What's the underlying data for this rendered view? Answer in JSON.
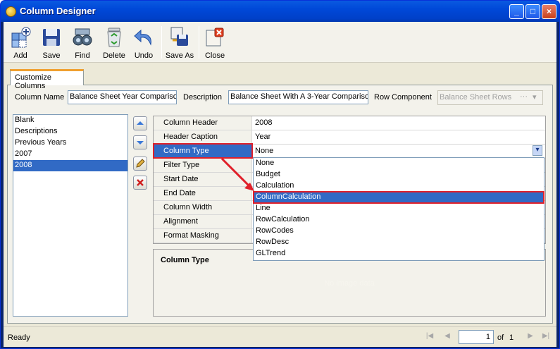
{
  "window": {
    "title": "Column Designer",
    "minimize": "_",
    "maximize": "□",
    "close": "×"
  },
  "toolbar": {
    "add": "Add",
    "save": "Save",
    "find": "Find",
    "delete": "Delete",
    "undo": "Undo",
    "save_as": "Save As",
    "close": "Close"
  },
  "tab": {
    "label": "Customize Columns"
  },
  "form": {
    "column_name_label": "Column Name",
    "column_name_value": "Balance Sheet Year Comparison",
    "description_label": "Description",
    "description_value": "Balance Sheet With A 3-Year Comparison",
    "row_component_label": "Row Component",
    "row_component_value": "Balance Sheet Rows"
  },
  "columns_list": [
    "Blank",
    "Descriptions",
    "Previous Years",
    "2007",
    "2008"
  ],
  "columns_selected": "2008",
  "properties": [
    {
      "key": "Column Header",
      "value": "2008"
    },
    {
      "key": "Header Caption",
      "value": "Year"
    },
    {
      "key": "Column Type",
      "value": "None"
    },
    {
      "key": "Filter Type",
      "value": ""
    },
    {
      "key": "Start Date",
      "value": ""
    },
    {
      "key": "End Date",
      "value": ""
    },
    {
      "key": "Column Width",
      "value": ""
    },
    {
      "key": "Alignment",
      "value": ""
    },
    {
      "key": "Format Masking",
      "value": ""
    }
  ],
  "dropdown_options": [
    "None",
    "Budget",
    "Calculation",
    "ColumnCalculation",
    "Line",
    "RowCalculation",
    "RowCodes",
    "RowDesc",
    "GLTrend"
  ],
  "dropdown_highlighted": "ColumnCalculation",
  "description_panel": {
    "title": "Column Type",
    "empty_text": "No image data"
  },
  "status": {
    "text": "Ready",
    "page": "1",
    "of_label": "of",
    "total": "1"
  },
  "colors": {
    "title_bar": "#0054e3",
    "selection": "#316ac5",
    "annotation": "#e0202a"
  }
}
